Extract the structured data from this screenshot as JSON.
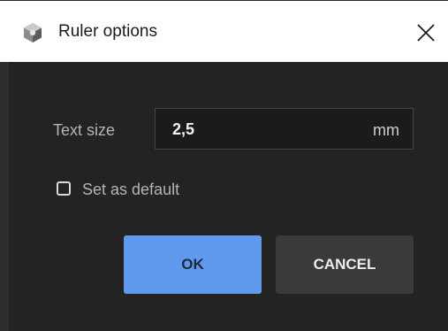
{
  "dialog": {
    "title": "Ruler options",
    "app_icon": "cube-icon",
    "close_icon": "close-icon"
  },
  "text_size": {
    "label": "Text size",
    "value": "2,5",
    "unit": "mm"
  },
  "default_checkbox": {
    "label": "Set as default",
    "checked": false
  },
  "buttons": {
    "ok": "OK",
    "cancel": "CANCEL"
  },
  "colors": {
    "dialog_background": "#232323",
    "titlebar": "#ffffff",
    "ok_button": "#6199ec",
    "cancel_button": "#3a3a3a"
  }
}
